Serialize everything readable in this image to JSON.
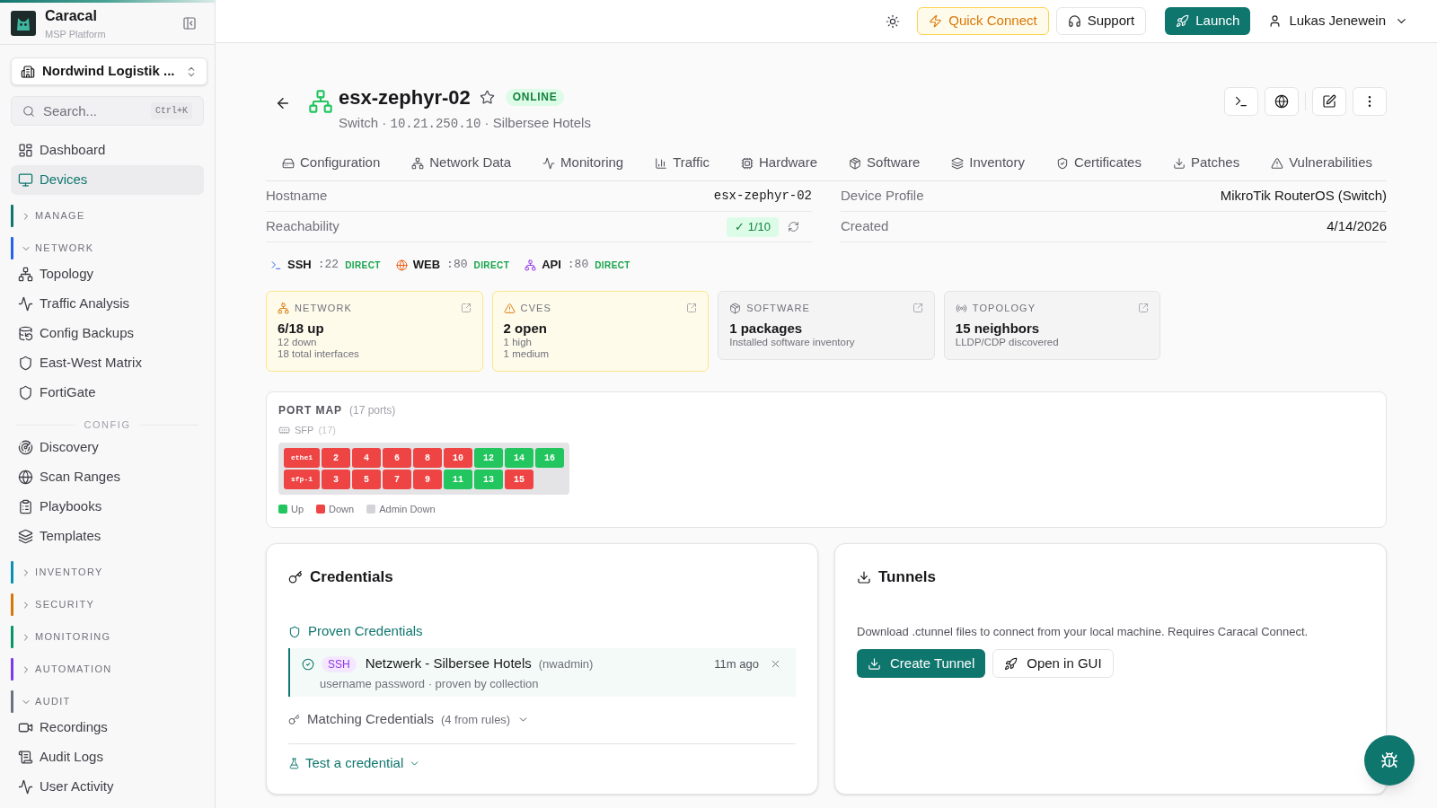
{
  "sidebar": {
    "brand": {
      "name": "Caracal",
      "tagline": "MSP Platform"
    },
    "organization": "Nordwind Logistik ...",
    "search": {
      "placeholder": "Search...",
      "shortcut": "Ctrl+K"
    },
    "nav": [
      {
        "kind": "link",
        "label": "Dashboard",
        "selected": false
      },
      {
        "kind": "link",
        "label": "Devices",
        "selected": true
      },
      {
        "kind": "section",
        "label": "MANAGE",
        "color": "#0f766e",
        "expanded": false
      },
      {
        "kind": "section",
        "label": "NETWORK",
        "color": "#2563eb",
        "expanded": true,
        "children": [
          {
            "kind": "link",
            "label": "Topology",
            "selected": false
          },
          {
            "kind": "link",
            "label": "Traffic Analysis",
            "selected": false
          },
          {
            "kind": "link",
            "label": "Config Backups",
            "selected": false
          },
          {
            "kind": "link",
            "label": "East-West Matrix",
            "selected": false
          },
          {
            "kind": "link",
            "label": "FortiGate",
            "selected": false
          },
          {
            "kind": "heading",
            "label": "CONFIG"
          },
          {
            "kind": "link",
            "label": "Discovery",
            "selected": false
          },
          {
            "kind": "link",
            "label": "Scan Ranges",
            "selected": false
          },
          {
            "kind": "link",
            "label": "Playbooks",
            "selected": false
          },
          {
            "kind": "link",
            "label": "Templates",
            "selected": false
          }
        ]
      },
      {
        "kind": "section",
        "label": "INVENTORY",
        "color": "#0891b2",
        "expanded": false
      },
      {
        "kind": "section",
        "label": "SECURITY",
        "color": "#d97706",
        "expanded": false
      },
      {
        "kind": "section",
        "label": "MONITORING",
        "color": "#059669",
        "expanded": false
      },
      {
        "kind": "section",
        "label": "AUTOMATION",
        "color": "#7c3aed",
        "expanded": false
      },
      {
        "kind": "section",
        "label": "AUDIT",
        "color": "#6b7280",
        "expanded": true,
        "children": [
          {
            "kind": "link",
            "label": "Recordings",
            "selected": false
          },
          {
            "kind": "link",
            "label": "Audit Logs",
            "selected": false
          },
          {
            "kind": "link",
            "label": "User Activity",
            "selected": false
          }
        ]
      }
    ]
  },
  "top_bar": {
    "actions": [
      {
        "kind": "accent",
        "label": "Quick Connect"
      },
      {
        "kind": "outline",
        "label": "Support"
      },
      {
        "kind": "primary",
        "label": "Launch"
      }
    ],
    "user": "Lukas Jenewein"
  },
  "device": {
    "name": "esx-zephyr-02",
    "favorite": false,
    "status": "ONLINE",
    "subtitle": [
      {
        "kind": "text",
        "text": "Switch"
      },
      {
        "kind": "separator",
        "text": "·"
      },
      {
        "kind": "mono",
        "text": "10.21.250.10"
      },
      {
        "kind": "separator",
        "text": "·"
      },
      {
        "kind": "text",
        "text": "Silbersee Hotels"
      }
    ]
  },
  "tabs": [
    {
      "label": "Configuration",
      "selected": false
    },
    {
      "label": "Network Data",
      "selected": false
    },
    {
      "label": "Monitoring",
      "selected": false
    },
    {
      "label": "Traffic",
      "selected": false
    },
    {
      "label": "Hardware",
      "selected": false
    },
    {
      "label": "Software",
      "selected": false
    },
    {
      "label": "Inventory",
      "selected": false
    },
    {
      "label": "Certificates",
      "selected": false
    },
    {
      "label": "Patches",
      "selected": false
    },
    {
      "label": "Vulnerabilities",
      "selected": false
    }
  ],
  "properties": [
    {
      "kind": "mono",
      "label": "Hostname",
      "value": "esx-zephyr-02"
    },
    {
      "kind": "text",
      "label": "Device Profile",
      "value": "MikroTik RouterOS (Switch)"
    },
    {
      "kind": "badge",
      "label": "Reachability",
      "value": "✓ 1/10"
    },
    {
      "kind": "text",
      "label": "Created",
      "value": "4/14/2026"
    }
  ],
  "protocols": [
    {
      "name": "SSH",
      "port": ":22",
      "mode": "DIRECT"
    },
    {
      "name": "WEB",
      "port": ":80",
      "mode": "DIRECT"
    },
    {
      "name": "API",
      "port": ":80",
      "mode": "DIRECT"
    }
  ],
  "summary_cards": [
    {
      "warning": true,
      "label": "NETWORK",
      "value": "6/18 up",
      "details": [
        "12 down",
        "18 total interfaces"
      ]
    },
    {
      "warning": true,
      "label": "CVES",
      "value": "2 open",
      "details": [
        "1 high",
        "1 medium"
      ]
    },
    {
      "warning": false,
      "label": "SOFTWARE",
      "value": "1 packages",
      "details": [
        "Installed software inventory"
      ]
    },
    {
      "warning": false,
      "label": "TOPOLOGY",
      "value": "15 neighbors",
      "details": [
        "LLDP/CDP discovered"
      ]
    }
  ],
  "port_map": {
    "title": "PORT MAP",
    "count": "(17 ports)",
    "group": {
      "label": "SFP",
      "count": "(17)"
    },
    "rows": [
      {
        "ports": [
          {
            "label": "ethe1",
            "up": false
          },
          {
            "label": "2",
            "up": false
          },
          {
            "label": "4",
            "up": false
          },
          {
            "label": "6",
            "up": false
          },
          {
            "label": "8",
            "up": false
          },
          {
            "label": "10",
            "up": false
          },
          {
            "label": "12",
            "up": true
          },
          {
            "label": "14",
            "up": true
          },
          {
            "label": "16",
            "up": true
          }
        ]
      },
      {
        "ports": [
          {
            "label": "sfp-1",
            "up": false
          },
          {
            "label": "3",
            "up": false
          },
          {
            "label": "5",
            "up": false
          },
          {
            "label": "7",
            "up": false
          },
          {
            "label": "9",
            "up": false
          },
          {
            "label": "11",
            "up": true
          },
          {
            "label": "13",
            "up": true
          },
          {
            "label": "15",
            "up": false
          }
        ]
      }
    ],
    "legend": [
      {
        "label": "Up",
        "color": "#22c55e"
      },
      {
        "label": "Down",
        "color": "#ef4444"
      },
      {
        "label": "Admin Down",
        "color": "#d4d4d8"
      }
    ]
  },
  "credentials": {
    "title": "Credentials",
    "proven": {
      "title": "Proven Credentials",
      "items": [
        {
          "protocol": "SSH",
          "name": "Netzwerk - Silbersee Hotels",
          "user": "(nwadmin)",
          "time": "11m ago",
          "detail": "username password · proven by collection"
        }
      ]
    },
    "matching": {
      "title": "Matching Credentials",
      "count": "(4 from rules)",
      "expanded": false
    },
    "test": {
      "label": "Test a credential",
      "expanded": false
    }
  },
  "tunnels": {
    "title": "Tunnels",
    "description": "Download .ctunnel files to connect from your local machine. Requires Caracal Connect.",
    "actions": [
      {
        "kind": "primary",
        "label": "Create Tunnel"
      },
      {
        "kind": "outline",
        "label": "Open in GUI"
      }
    ]
  }
}
